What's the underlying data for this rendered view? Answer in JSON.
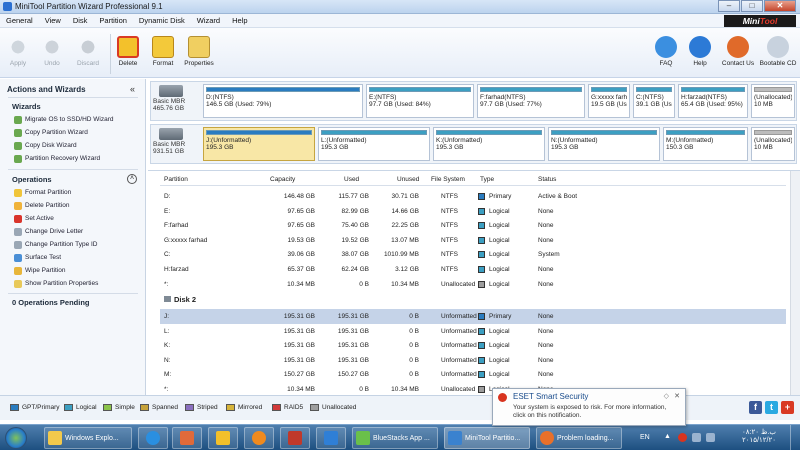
{
  "window": {
    "title": "MiniTool Partition Wizard Professional 9.1",
    "brand": "Mini",
    "brand_accent": "Tool"
  },
  "menu": [
    "General",
    "View",
    "Disk",
    "Partition",
    "Dynamic Disk",
    "Wizard",
    "Help"
  ],
  "toolbar": {
    "apply": "Apply",
    "undo": "Undo",
    "discard": "Discard",
    "delete": "Delete",
    "format": "Format",
    "properties": "Properties",
    "faq": "FAQ",
    "help": "Help",
    "contact": "Contact Us",
    "bootable": "Bootable CD"
  },
  "left_panel": {
    "title": "Actions and Wizards",
    "wizards_title": "Wizards",
    "wizards": [
      "Migrate OS to SSD/HD Wizard",
      "Copy Partition Wizard",
      "Copy Disk Wizard",
      "Partition Recovery Wizard"
    ],
    "operations_title": "Operations",
    "operations": [
      "Format Partition",
      "Delete Partition",
      "Set Active",
      "Change Drive Letter",
      "Change Partition Type ID",
      "Surface Test",
      "Wipe Partition",
      "Show Partition Properties"
    ],
    "pending": "0 Operations Pending"
  },
  "disk1": {
    "type": "Basic MBR",
    "size": "465.76 GB",
    "parts": [
      {
        "label": "D:(NTFS)",
        "detail": "146.5 GB (Used: 79%)",
        "used": 0.79
      },
      {
        "label": "E:(NTFS)",
        "detail": "97.7 GB (Used: 84%)",
        "used": 0.84
      },
      {
        "label": "F:farhad(NTFS)",
        "detail": "97.7 GB (Used: 77%)",
        "used": 0.77
      },
      {
        "label": "G:xxxxx farha",
        "detail": "19.5 GB (Used",
        "used": 1.0
      },
      {
        "label": "C:(NTFS)",
        "detail": "39.1 GB (Use",
        "used": 0.97
      },
      {
        "label": "H:farzad(NTFS)",
        "detail": "65.4 GB (Used: 95%)",
        "used": 0.95
      },
      {
        "label": "(Unallocated)",
        "detail": "10 MB",
        "used": 0
      }
    ]
  },
  "disk2": {
    "type": "Basic MBR",
    "size": "931.51 GB",
    "parts": [
      {
        "label": "J:(Unformatted)",
        "detail": "195.3 GB"
      },
      {
        "label": "L:(Unformatted)",
        "detail": "195.3 GB"
      },
      {
        "label": "K:(Unformatted)",
        "detail": "195.3 GB"
      },
      {
        "label": "N:(Unformatted)",
        "detail": "195.3 GB"
      },
      {
        "label": "M:(Unformatted)",
        "detail": "150.3 GB"
      },
      {
        "label": "(Unallocated)",
        "detail": "10 MB"
      }
    ]
  },
  "grid": {
    "columns": [
      "Partition",
      "Capacity",
      "Used",
      "Unused",
      "File System",
      "Type",
      "Status"
    ],
    "disk2_label": "Disk 2",
    "rows1": [
      [
        "D:",
        "146.48 GB",
        "115.77 GB",
        "30.71 GB",
        "NTFS",
        "Primary",
        "Active & Boot"
      ],
      [
        "E:",
        "97.65 GB",
        "82.99 GB",
        "14.66 GB",
        "NTFS",
        "Logical",
        "None"
      ],
      [
        "F:farhad",
        "97.65 GB",
        "75.40 GB",
        "22.25 GB",
        "NTFS",
        "Logical",
        "None"
      ],
      [
        "G:xxxxx farhad",
        "19.53 GB",
        "19.52 GB",
        "13.07 MB",
        "NTFS",
        "Logical",
        "None"
      ],
      [
        "C:",
        "39.06 GB",
        "38.07 GB",
        "1010.99 MB",
        "NTFS",
        "Logical",
        "System"
      ],
      [
        "H:farzad",
        "65.37 GB",
        "62.24 GB",
        "3.12 GB",
        "NTFS",
        "Logical",
        "None"
      ],
      [
        "*:",
        "10.34 MB",
        "0 B",
        "10.34 MB",
        "Unallocated",
        "Logical",
        "None"
      ]
    ],
    "rows2": [
      [
        "J:",
        "195.31 GB",
        "195.31 GB",
        "0 B",
        "Unformatted",
        "Primary",
        "None"
      ],
      [
        "L:",
        "195.31 GB",
        "195.31 GB",
        "0 B",
        "Unformatted",
        "Logical",
        "None"
      ],
      [
        "K:",
        "195.31 GB",
        "195.31 GB",
        "0 B",
        "Unformatted",
        "Logical",
        "None"
      ],
      [
        "N:",
        "195.31 GB",
        "195.31 GB",
        "0 B",
        "Unformatted",
        "Logical",
        "None"
      ],
      [
        "M:",
        "150.27 GB",
        "150.27 GB",
        "0 B",
        "Unformatted",
        "Logical",
        "None"
      ],
      [
        "*:",
        "10.34 MB",
        "0 B",
        "10.34 MB",
        "Unallocated",
        "Logical",
        "None"
      ]
    ]
  },
  "legend": [
    "GPT/Primary",
    "Logical",
    "Simple",
    "Spanned",
    "Striped",
    "Mirrored",
    "RAID5",
    "Unallocated"
  ],
  "legend_colors": [
    "#2a7cc0",
    "#3c9fc2",
    "#8bc34a",
    "#c7a33a",
    "#8a6fbf",
    "#d6b43a",
    "#d23a3a",
    "#9e9e9e"
  ],
  "notification": {
    "title": "ESET Smart Security",
    "body": "Your system is exposed to risk. For more information, click on this notification."
  },
  "taskbar": {
    "items": [
      "Windows Explo...",
      "BlueStacks App ...",
      "MiniTool Partitio...",
      "Problem loading..."
    ],
    "lang": "EN",
    "time": "۰۸:۲۰ ب.ظ",
    "date": "۲۰۱۵/۱۲/۲۰"
  }
}
